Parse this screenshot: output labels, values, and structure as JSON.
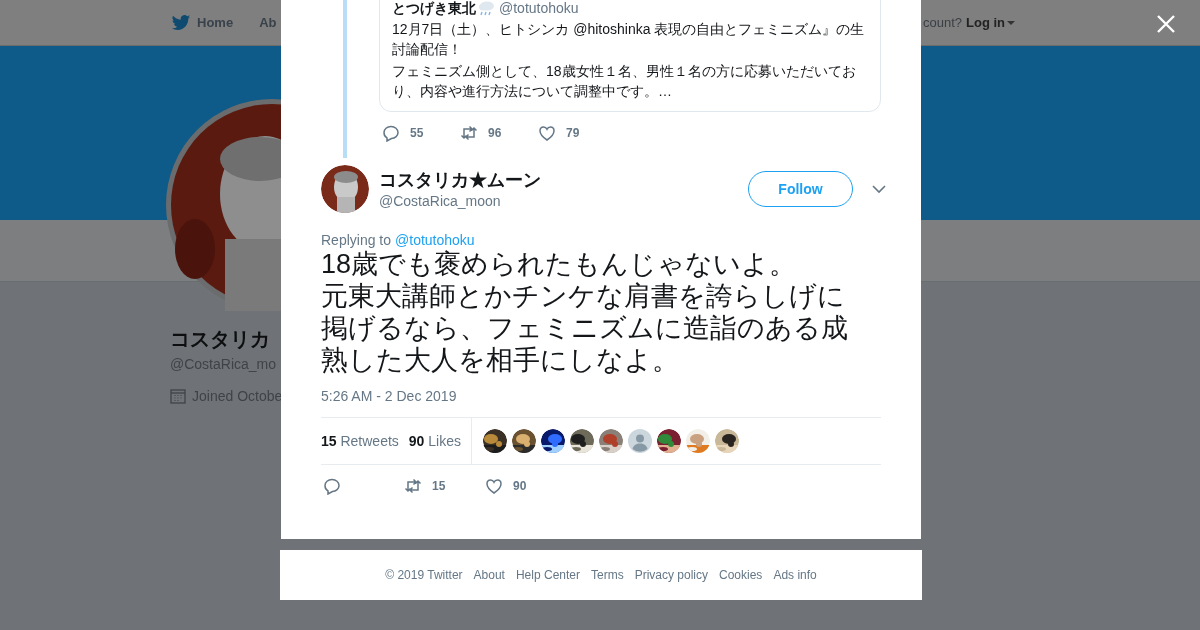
{
  "background_page": {
    "nav": {
      "items": [
        "Home",
        "Ab"
      ],
      "account_prompt": "count?",
      "login": "Log in"
    },
    "profile": {
      "name": "コスタリカ",
      "handle": "@CostaRica_mo",
      "joined": "Joined Octobe"
    }
  },
  "modal": {
    "quoted_tweet": {
      "name": "とつげき東北",
      "handle": "@totutohoku",
      "paragraphs": [
        "12月7日（土）、ヒトシンカ @hitoshinka 表現の自由とフェミニズム』の生討論配信！",
        "フェミニズム側として、18歳女性１名、男性１名の方に応募いただいており、内容や進行方法について調整中です。…"
      ],
      "actions": [
        {
          "kind": "reply",
          "count": "55"
        },
        {
          "kind": "retweet",
          "count": "96"
        },
        {
          "kind": "like",
          "count": "79"
        }
      ]
    },
    "tweet": {
      "name": "コスタリカ★ムーン",
      "handle": "@CostaRica_moon",
      "follow_button": "Follow",
      "replying_label": "Replying to",
      "replying_to": "@totutohoku",
      "text_lines": [
        "18歳でも褒められたもんじゃないよ。",
        "元東大講師とかチンケな肩書を誇らしげに掲げるなら、フェミニズムに造詣のある成熟した大人を相手にしなよ。"
      ],
      "time": "5:26 AM - 2 Dec 2019",
      "stats": [
        {
          "count": "15",
          "label": "Retweets"
        },
        {
          "count": "90",
          "label": "Likes"
        }
      ],
      "likers": [
        {
          "kind": "picture"
        },
        {
          "kind": "picture"
        },
        {
          "kind": "picture"
        },
        {
          "kind": "picture"
        },
        {
          "kind": "picture"
        },
        {
          "kind": "default"
        },
        {
          "kind": "picture"
        },
        {
          "kind": "picture"
        },
        {
          "kind": "picture"
        }
      ],
      "actions": [
        {
          "kind": "reply"
        },
        {
          "kind": "retweet",
          "count": "15"
        },
        {
          "kind": "like",
          "count": "90"
        }
      ]
    }
  },
  "footer": {
    "links": [
      "© 2019 Twitter",
      "About",
      "Help Center",
      "Terms",
      "Privacy policy",
      "Cookies",
      "Ads info"
    ]
  }
}
